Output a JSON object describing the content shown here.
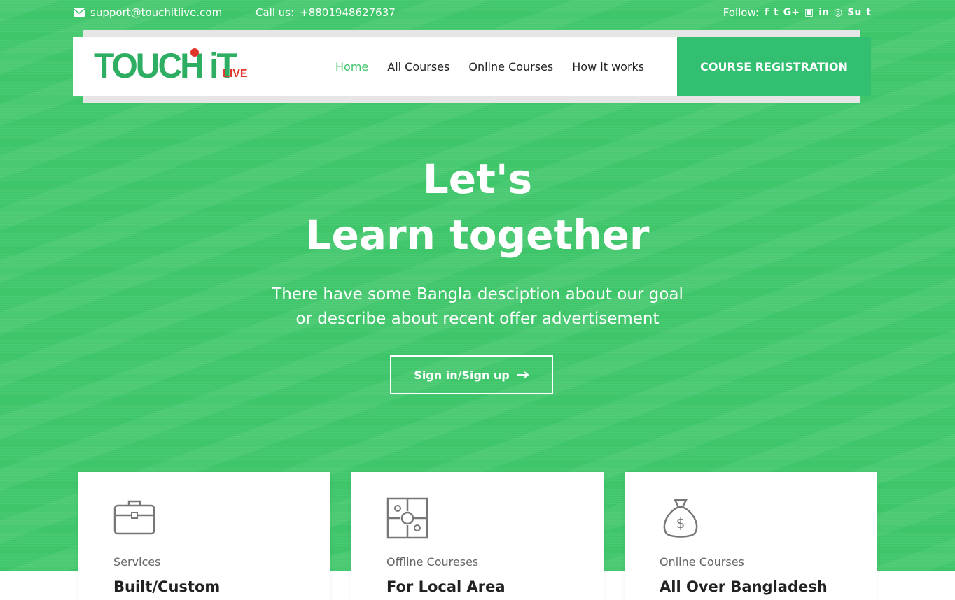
{
  "topbar": {
    "email": "support@touchitlive.com",
    "call_label": "Call us:",
    "phone": "+8801948627637",
    "follow_label": "Follow:",
    "social": [
      {
        "name": "facebook-icon",
        "glyph": "f"
      },
      {
        "name": "twitter-icon",
        "glyph": "t"
      },
      {
        "name": "google-plus-icon",
        "glyph": "G+"
      },
      {
        "name": "youtube-icon",
        "glyph": "▣"
      },
      {
        "name": "linkedin-icon",
        "glyph": "in"
      },
      {
        "name": "instagram-icon",
        "glyph": "◎"
      },
      {
        "name": "stumbleupon-icon",
        "glyph": "Su"
      },
      {
        "name": "tumblr-icon",
        "glyph": "t"
      }
    ]
  },
  "nav": {
    "logo_main": "TOUCH iT",
    "logo_sub": "LIVE",
    "items": [
      "Home",
      "All Courses",
      "Online Courses",
      "How it works"
    ],
    "cta": "COURSE REGISTRATION"
  },
  "hero": {
    "line1": "Let's",
    "line2": "Learn together",
    "desc1": "There have some Bangla desciption about our goal",
    "desc2": "or describe about recent offer advertisement",
    "button": "Sign in/Sign up"
  },
  "cards": [
    {
      "icon": "briefcase-icon",
      "category": "Services",
      "title": "Built/Custom"
    },
    {
      "icon": "puzzle-icon",
      "category": "Offline Coureses",
      "title": "For Local Area"
    },
    {
      "icon": "money-bag-icon",
      "category": "Online Courses",
      "title": "All Over Bangladesh"
    }
  ]
}
